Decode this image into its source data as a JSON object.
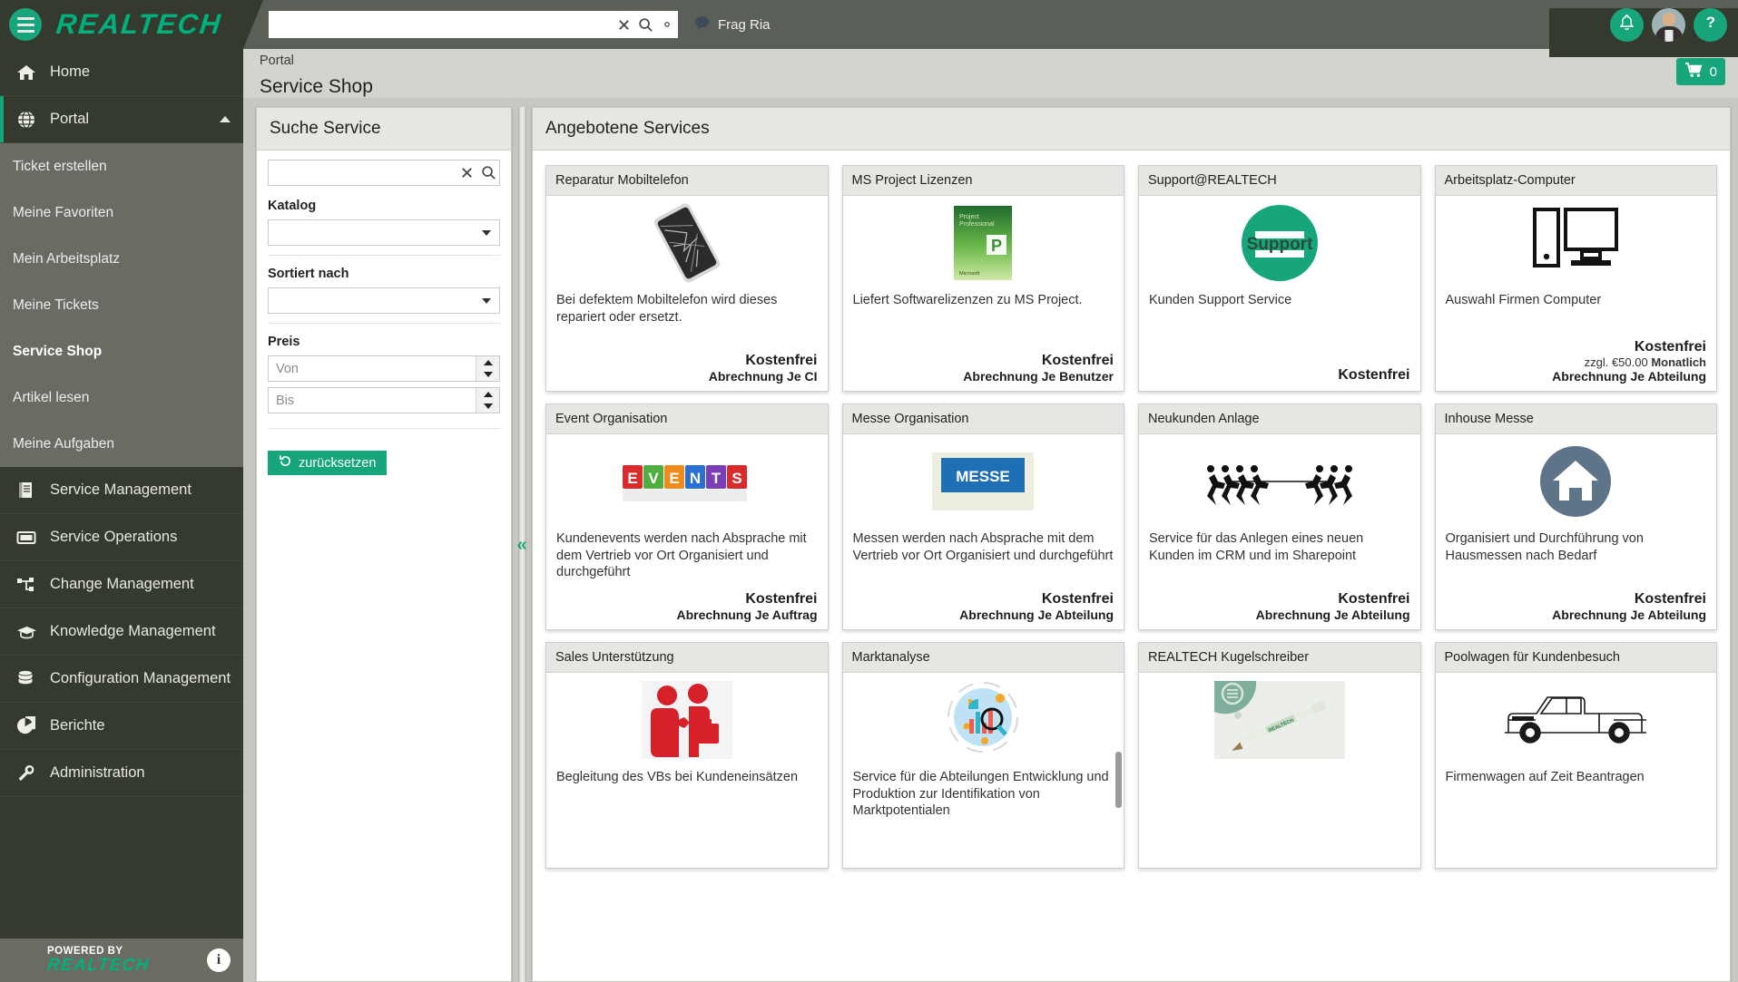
{
  "topbar": {
    "brand": "REALTECH",
    "search_value": "",
    "search_placeholder": "",
    "clear_icon": "clear-x-icon",
    "search_icon": "search-icon",
    "settings_icon": "gear-icon",
    "assistant_label": "Frag Ria",
    "notification_icon": "bell-icon",
    "help_icon": "question-mark-icon",
    "avatar": "user-avatar"
  },
  "sidebar": {
    "home": {
      "label": "Home",
      "icon": "home-icon"
    },
    "portal": {
      "label": "Portal",
      "icon": "globe-icon"
    },
    "portal_items": [
      {
        "label": "Ticket erstellen",
        "current": false
      },
      {
        "label": "Meine Favoriten",
        "current": false
      },
      {
        "label": "Mein Arbeitsplatz",
        "current": false
      },
      {
        "label": "Meine Tickets",
        "current": false
      },
      {
        "label": "Service Shop",
        "current": true
      },
      {
        "label": "Artikel lesen",
        "current": false
      },
      {
        "label": "Meine Aufgaben",
        "current": false
      }
    ],
    "modules": [
      {
        "label": "Service Management",
        "icon": "book-icon"
      },
      {
        "label": "Service Operations",
        "icon": "ticket-icon"
      },
      {
        "label": "Change Management",
        "icon": "network-icon"
      },
      {
        "label": "Knowledge Management",
        "icon": "graduation-cap-icon"
      },
      {
        "label": "Configuration Management",
        "icon": "database-icon"
      },
      {
        "label": "Berichte",
        "icon": "pie-chart-icon"
      },
      {
        "label": "Administration",
        "icon": "wrench-icon"
      }
    ],
    "footer": {
      "powered_by": "POWERED BY",
      "brand": "REALTECH",
      "info_icon": "info-icon",
      "info_label": "i"
    }
  },
  "header": {
    "breadcrumb": "Portal",
    "title": "Service Shop",
    "cart_icon": "shopping-cart-icon",
    "cart_count": "0"
  },
  "search_panel": {
    "title": "Suche Service",
    "query_value": "",
    "query_placeholder": "",
    "clear_icon": "clear-x-icon",
    "search_icon": "search-icon",
    "katalog_label": "Katalog",
    "katalog_value": "",
    "sort_label": "Sortiert nach",
    "sort_value": "",
    "price_label": "Preis",
    "price_from_value": "",
    "price_from_placeholder": "Von",
    "price_to_value": "",
    "price_to_placeholder": "Bis",
    "reset_label": "zurücksetzen",
    "reset_icon": "undo-icon",
    "collapse_icon": "double-chevron-left-icon"
  },
  "services_panel": {
    "title": "Angebotene Services",
    "cards": [
      {
        "title": "Reparatur Mobiltelefon",
        "image": "cracked-smartphone-photo",
        "description": "Bei defektem Mobiltelefon wird dieses repariert oder ersetzt.",
        "price": "Kostenfrei",
        "extra": "",
        "billing": "Abrechnung Je CI"
      },
      {
        "title": "MS Project Lizenzen",
        "image": "ms-project-box-photo",
        "description": "Liefert Softwarelizenzen zu MS Project.",
        "price": "Kostenfrei",
        "extra": "",
        "billing": "Abrechnung Je Benutzer"
      },
      {
        "title": "Support@REALTECH",
        "image": "support-badge-icon",
        "description": "Kunden Support Service",
        "price": "Kostenfrei",
        "extra": "",
        "billing": ""
      },
      {
        "title": "Arbeitsplatz-Computer",
        "image": "desktop-computer-icon",
        "description": "Auswahl Firmen Computer",
        "price": "Kostenfrei",
        "extra_prefix": "zzgl. €50.00 ",
        "extra_bold": "Monatlich",
        "billing": "Abrechnung Je Abteilung"
      },
      {
        "title": "Event Organisation",
        "image": "events-cubes-photo",
        "description": "Kundenevents werden nach Absprache mit dem Vertrieb vor Ort Organisiert und durchgeführt",
        "price": "Kostenfrei",
        "extra": "",
        "billing": "Abrechnung Je Auftrag"
      },
      {
        "title": "Messe Organisation",
        "image": "messe-sign-photo",
        "description": "Messen werden nach Absprache mit dem Vertrieb vor Ort Organisiert und durchgeführt",
        "price": "Kostenfrei",
        "extra": "",
        "billing": "Abrechnung Je Abteilung"
      },
      {
        "title": "Neukunden Anlage",
        "image": "tug-of-war-icon",
        "description": "Service für das Anlegen eines neuen Kunden im CRM und im Sharepoint",
        "price": "Kostenfrei",
        "extra": "",
        "billing": "Abrechnung Je Abteilung"
      },
      {
        "title": "Inhouse Messe",
        "image": "house-circle-icon",
        "description": "Organisiert und Durchführung von Hausmessen nach Bedarf",
        "price": "Kostenfrei",
        "extra": "",
        "billing": "Abrechnung Je Abteilung"
      },
      {
        "title": "Sales Unterstützung",
        "image": "handshake-icon",
        "description": "Begleitung des VBs bei Kundeneinsätzen",
        "price": "",
        "extra": "",
        "billing": ""
      },
      {
        "title": "Marktanalyse",
        "image": "market-analysis-icon",
        "description": "Service für die Abteilungen Entwicklung und Produktion zur Identifikation von Marktpotentialen",
        "price": "",
        "extra": "",
        "billing": ""
      },
      {
        "title": "REALTECH Kugelschreiber",
        "image": "ballpoint-pen-photo",
        "description": "",
        "price": "",
        "extra": "",
        "billing": ""
      },
      {
        "title": "Poolwagen für Kundenbesuch",
        "image": "pickup-truck-drawing",
        "description": "Firmenwagen auf Zeit Beantragen",
        "price": "",
        "extra": "",
        "billing": ""
      }
    ]
  }
}
